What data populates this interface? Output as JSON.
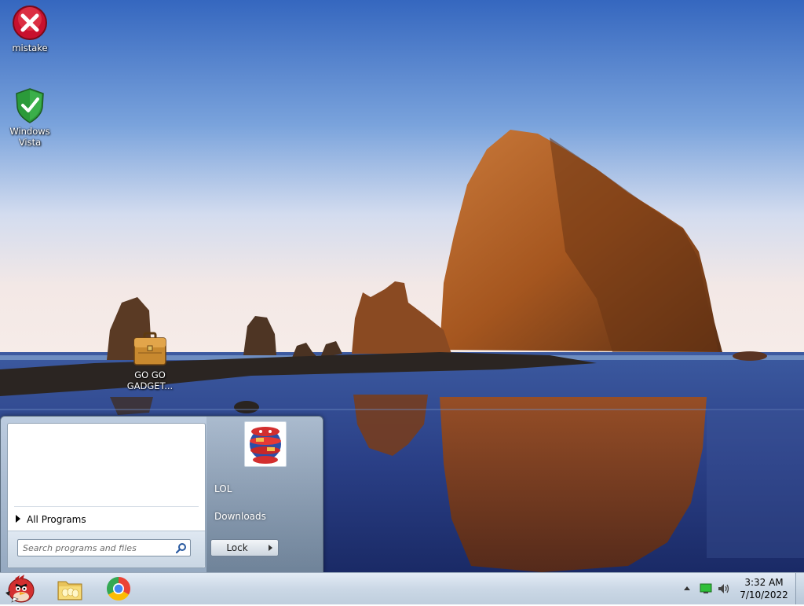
{
  "desktop": {
    "icons": [
      {
        "label": "mistake",
        "icon": "error-x-icon"
      },
      {
        "label": "Windows Vista",
        "icon": "security-shield-icon"
      },
      {
        "label": "GO GO GADGET...",
        "icon": "briefcase-icon"
      }
    ]
  },
  "start_menu": {
    "all_programs": "All Programs",
    "search_placeholder": "Search programs and files",
    "right_items": [
      "LOL",
      "Downloads"
    ],
    "lock_button": "Lock"
  },
  "taskbar": {
    "pinned": [
      {
        "name": "start-orb",
        "icon": "angry-bird-icon"
      },
      {
        "name": "file-explorer",
        "icon": "folder-icon"
      },
      {
        "name": "chrome",
        "icon": "chrome-icon"
      }
    ],
    "tray": {
      "time": "3:32 AM",
      "date": "7/10/2022"
    }
  },
  "colors": {
    "sky_top": "#3b6fc4",
    "sky_bottom": "#f2e9e6",
    "rock": "#b5652a",
    "sea": "#233a75",
    "taskbar": "#cbd8e6"
  }
}
